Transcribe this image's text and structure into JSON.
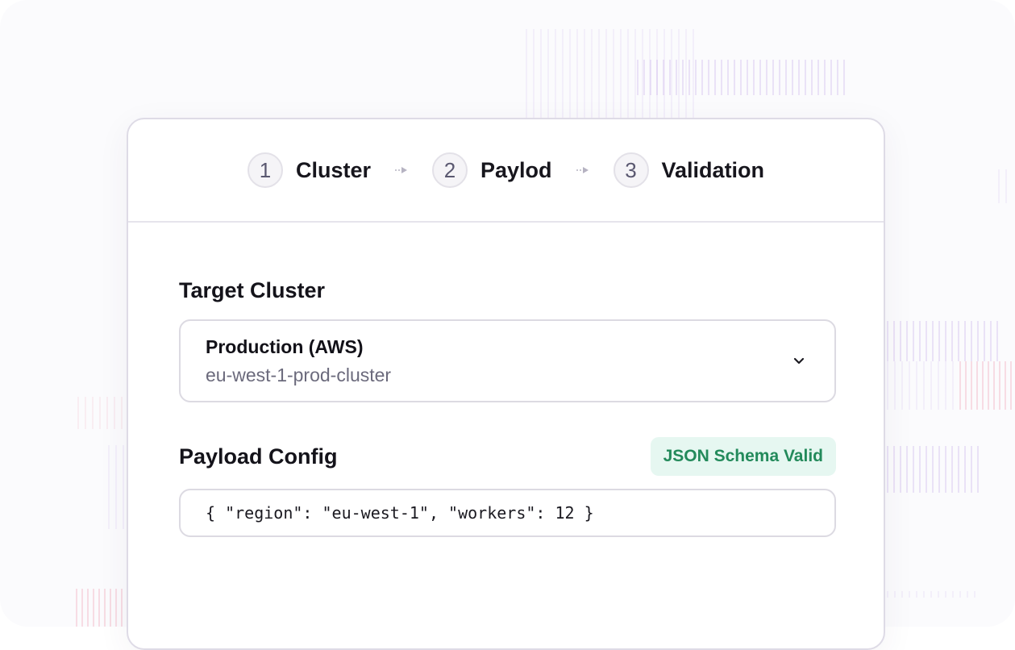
{
  "stepper": {
    "steps": [
      {
        "number": "1",
        "label": "Cluster"
      },
      {
        "number": "2",
        "label": "Paylod"
      },
      {
        "number": "3",
        "label": "Validation"
      }
    ]
  },
  "cluster": {
    "label": "Target Cluster",
    "selected_name": "Production (AWS)",
    "selected_id": "eu-west-1-prod-cluster",
    "chevron_icon": "chevron-down-icon"
  },
  "payload": {
    "label": "Payload Config",
    "badge": "JSON Schema Valid",
    "value": "{ \"region\": \"eu-west-1\", \"workers\": 12 }"
  },
  "colors": {
    "badge_bg": "#e6f7f1",
    "badge_text": "#238a5b",
    "step_circle": "#f5f4f7"
  }
}
